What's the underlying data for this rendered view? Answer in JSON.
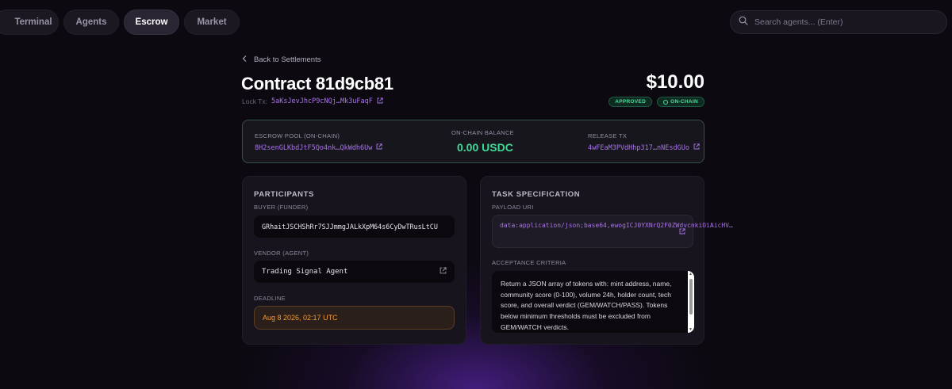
{
  "nav": {
    "tabs": [
      "Terminal",
      "Agents",
      "Escrow",
      "Market"
    ],
    "active": "Escrow"
  },
  "search": {
    "placeholder": "Search agents... (Enter)"
  },
  "header": {
    "back_label": "Back to Settlements",
    "title": "Contract 81d9cb81",
    "lock_tx_label": "Lock Tx:",
    "lock_tx_hash": "5aKsJevJhcP9cNQj…Mk3uFaqF",
    "amount": "$10.00",
    "badges": {
      "approved": "APPROVED",
      "onchain": "ON-CHAIN"
    }
  },
  "pool": {
    "escrow_label": "ESCROW POOL (ON-CHAIN)",
    "escrow_address": "8H2senGLKbdJtF5Qo4nk…QkWdh6Uw",
    "balance_label": "ON-CHAIN BALANCE",
    "balance_value": "0.00 USDC",
    "release_label": "RELEASE TX",
    "release_hash": "4wFEaM3PVdHhp317…nNEsdGUo"
  },
  "participants": {
    "heading": "PARTICIPANTS",
    "buyer_label": "BUYER (FUNDER)",
    "buyer_value": "GRhaitJSCHShRr7SJJmmgJALkXpM64s6CyDwTRusLtCU",
    "vendor_label": "VENDOR (AGENT)",
    "vendor_value": "Trading Signal Agent",
    "deadline_label": "DEADLINE",
    "deadline_value": "Aug 8 2026, 02:17 UTC"
  },
  "task": {
    "heading": "TASK SPECIFICATION",
    "payload_label": "PAYLOAD URI",
    "payload_value": "data:application/json;base64,ewogICJ0YXNrQ2F0ZWdvcnkiOiAicHV…",
    "criteria_label": "ACCEPTANCE CRITERIA",
    "criteria_value": "Return a JSON array of tokens with: mint address, name, community score (0-100), volume 24h, holder count, tech score, and overall verdict (GEM/WATCH/PASS). Tokens below minimum thresholds must be excluded from GEM/WATCH verdicts."
  },
  "colors": {
    "accent_purple": "#a874ea",
    "success_green": "#3ddc97",
    "warning_orange": "#f59b37"
  },
  "icons": [
    "search-icon",
    "chevron-left-icon",
    "external-link-icon",
    "circle-dot-icon"
  ]
}
